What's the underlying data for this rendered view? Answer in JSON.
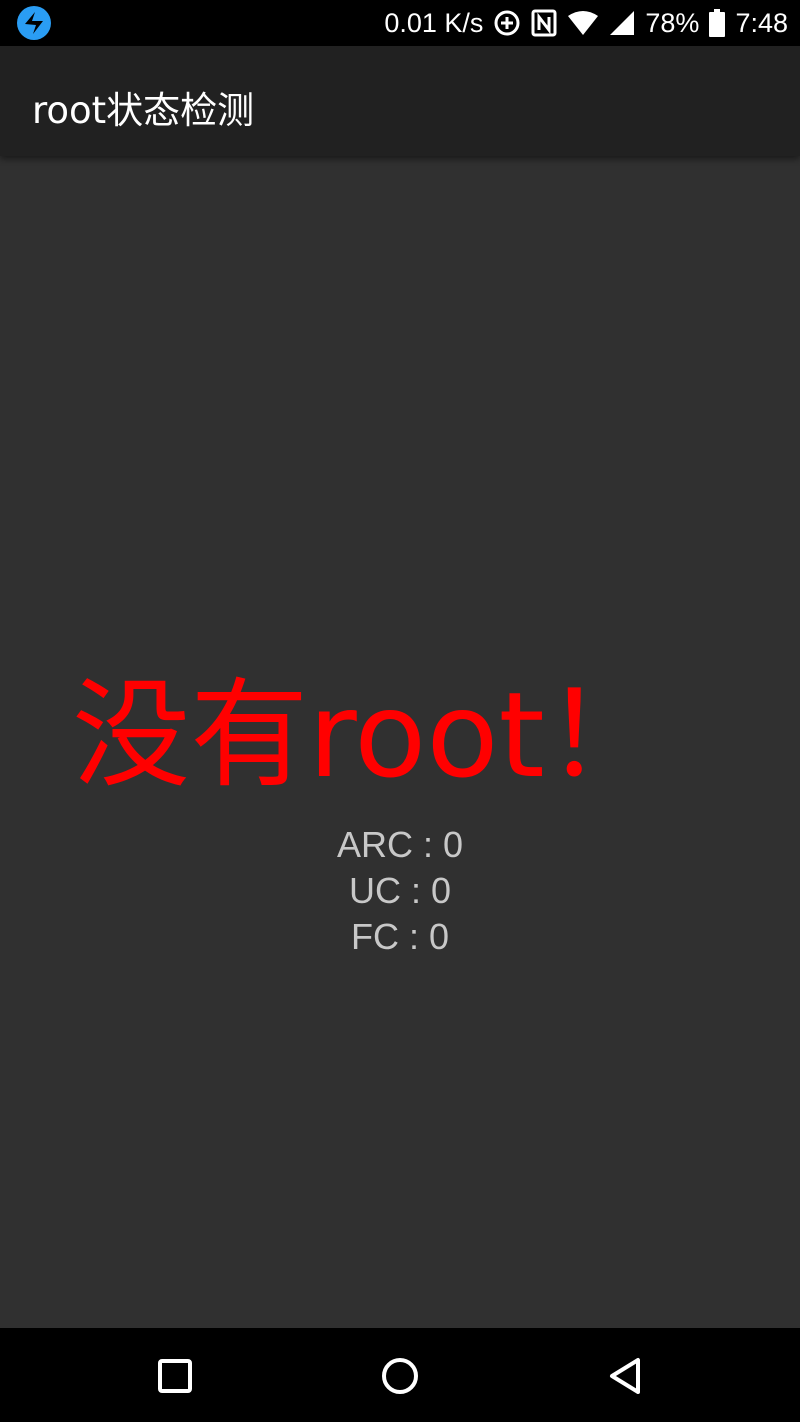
{
  "status_bar": {
    "network_speed": "0.01 K/s",
    "battery_percent": "78%",
    "time": "7:48",
    "icons": [
      "app-notification-icon",
      "data-saver-icon",
      "nfc-icon",
      "wifi-icon",
      "cell-signal-icon",
      "battery-icon"
    ]
  },
  "app_bar": {
    "title": "root状态检测"
  },
  "main": {
    "status_text": "没有root！",
    "status_color": "#ff0000",
    "counters": [
      {
        "label": "ARC : 0"
      },
      {
        "label": "UC : 0"
      },
      {
        "label": "FC : 0"
      }
    ]
  },
  "nav_bar": {
    "buttons": [
      "recents-icon",
      "home-icon",
      "back-icon"
    ]
  }
}
